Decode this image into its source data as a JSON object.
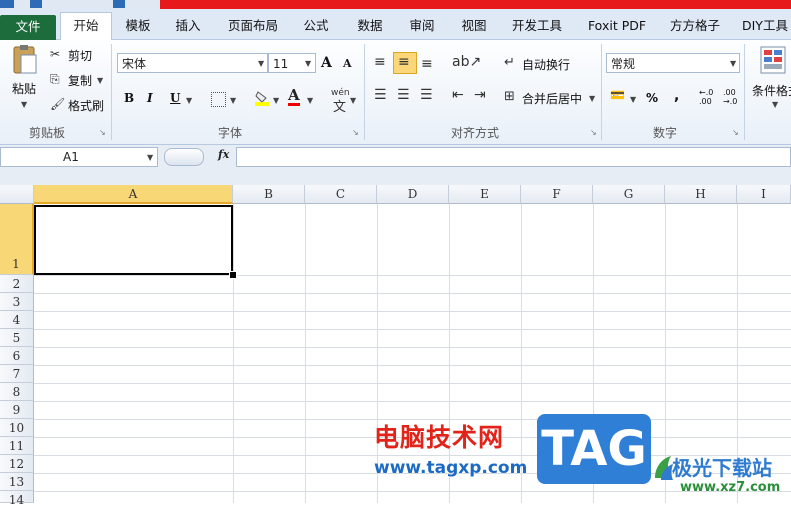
{
  "tabs": {
    "file": "文件",
    "home": "开始",
    "items": [
      "模板",
      "插入",
      "页面布局",
      "公式",
      "数据",
      "审阅",
      "视图",
      "开发工具",
      "Foxit PDF",
      "方方格子",
      "DIY工具"
    ]
  },
  "clipboard": {
    "paste": "粘贴",
    "cut": "剪切",
    "copy": "复制",
    "format_painter": "格式刷",
    "group_label": "剪贴板"
  },
  "font": {
    "name": "宋体",
    "size": "11",
    "bold": "B",
    "italic": "I",
    "underline": "U",
    "grow": "A",
    "shrink": "A",
    "font_color": "A",
    "phonetic": "wén",
    "group_label": "字体"
  },
  "alignment": {
    "wrap_text": "自动换行",
    "merge_center": "合并后居中",
    "group_label": "对齐方式"
  },
  "number": {
    "format": "常规",
    "percent": "%",
    "comma": ",",
    "inc_decimal": "←.0 .00",
    "dec_decimal": ".00 →.0",
    "group_label": "数字"
  },
  "styles": {
    "conditional_format": "条件格式"
  },
  "formula_bar": {
    "name_box": "A1",
    "fx": "fx",
    "formula": ""
  },
  "sheet": {
    "columns": [
      "A",
      "B",
      "C",
      "D",
      "E",
      "F",
      "G",
      "H",
      "I"
    ],
    "rows": [
      "1",
      "2",
      "3",
      "4",
      "5",
      "6",
      "7",
      "8",
      "9",
      "10",
      "11",
      "12",
      "13",
      "14"
    ],
    "active_cell": "A1"
  },
  "watermark": {
    "cn_text": "电脑技术网",
    "url": "www.tagxp.com",
    "tag": "TAG",
    "site_name": "极光下载站",
    "site_url": "www.xz7.com"
  },
  "colors": {
    "file_tab": "#1d6c3c",
    "selection_header": "#f8d876",
    "accent_red": "#e8191b",
    "ribbon_bg": "#e9f0f8"
  }
}
